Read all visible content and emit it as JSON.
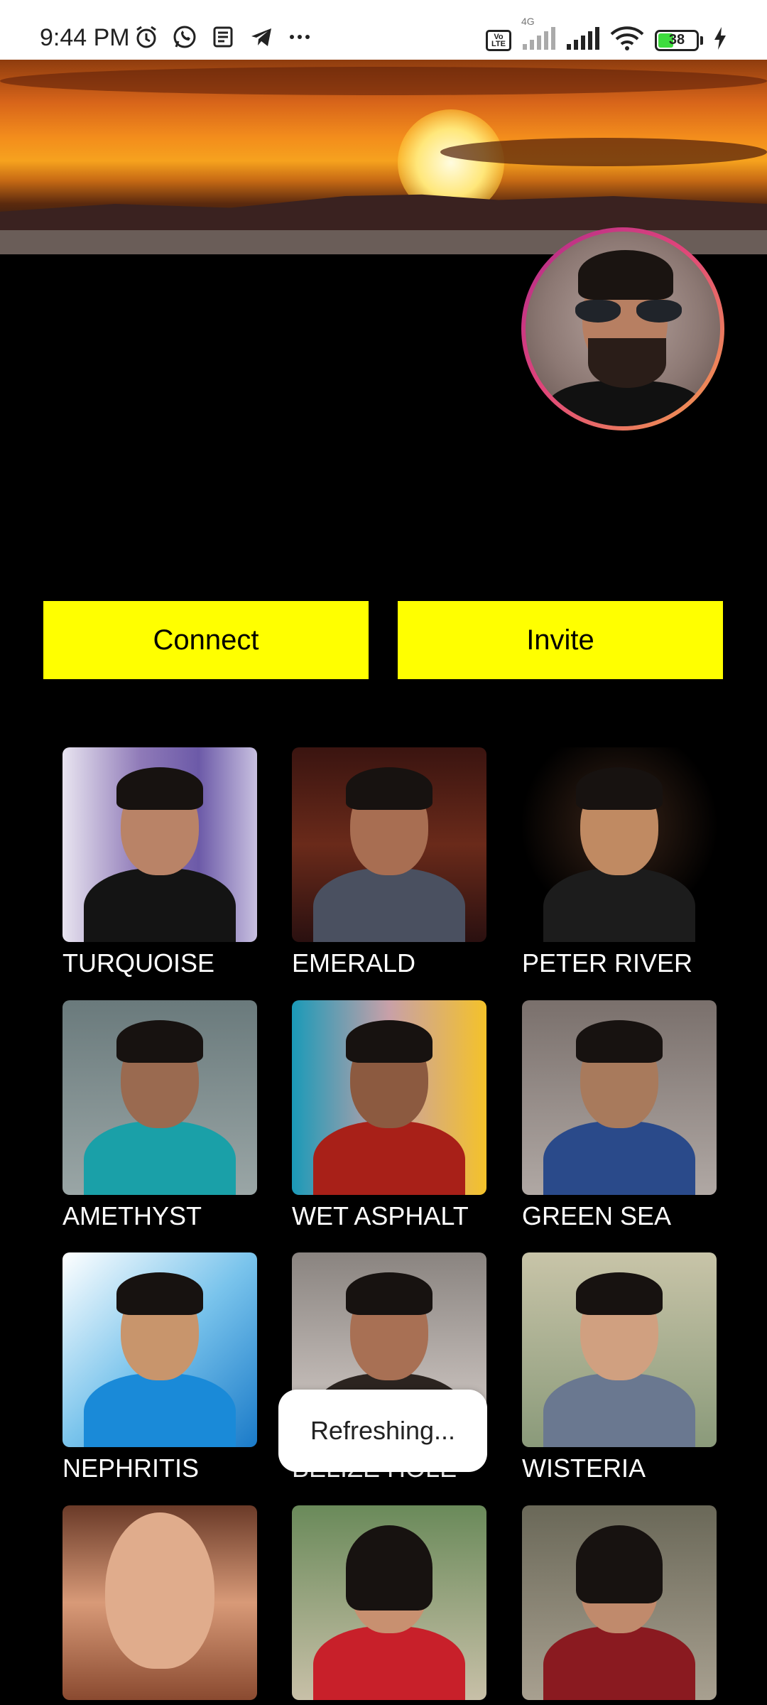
{
  "status_bar": {
    "time": "9:44 PM",
    "network": "4G",
    "volte": "Vo LTE",
    "battery": "38",
    "left_icons": [
      "alarm-icon",
      "whatsapp-icon",
      "news-icon",
      "telegram-icon",
      "more-icon"
    ],
    "right_icons": [
      "volte-icon",
      "signal-icon",
      "signal-icon",
      "wifi-icon",
      "battery-icon",
      "charging-icon"
    ]
  },
  "profile": {
    "cover": "sunset-banner-image",
    "avatar": "profile-avatar-image"
  },
  "actions": {
    "connect_label": "Connect",
    "invite_label": "Invite",
    "button_color": "#ffff00"
  },
  "grid": {
    "items": [
      {
        "label": "TURQUOISE"
      },
      {
        "label": "EMERALD"
      },
      {
        "label": "PETER RIVER"
      },
      {
        "label": "AMETHYST"
      },
      {
        "label": "WET ASPHALT"
      },
      {
        "label": "GREEN SEA"
      },
      {
        "label": "NEPHRITIS"
      },
      {
        "label": "BELIZE HOLE"
      },
      {
        "label": "WISTERIA"
      },
      {
        "label": ""
      },
      {
        "label": ""
      },
      {
        "label": ""
      }
    ]
  },
  "toast": {
    "text": "Refreshing..."
  }
}
